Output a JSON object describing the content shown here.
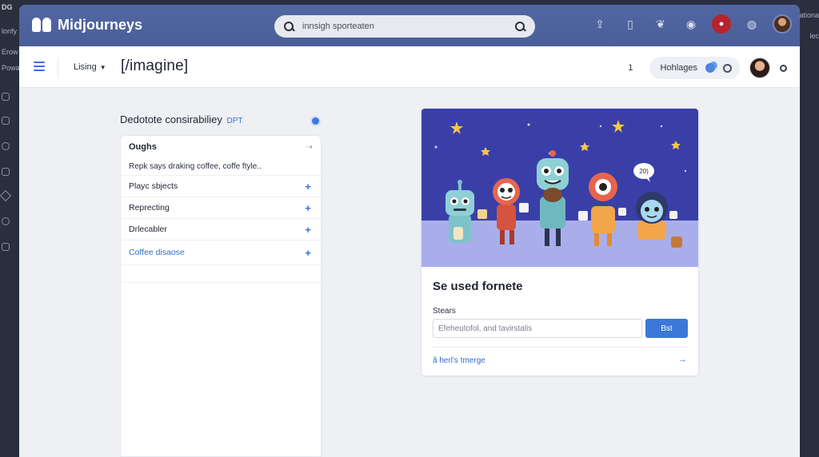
{
  "background": {
    "left_texts": [
      "DG",
      "lonfy",
      "Erow",
      "Powa"
    ],
    "right_texts": [
      "ationa",
      "lec"
    ]
  },
  "topbar": {
    "brand": "Midjourneys",
    "search_placeholder": "innsigh sporteaten",
    "icons": [
      "upload-icon",
      "bookmark-icon",
      "settings-swirl-icon",
      "location-icon",
      "record-icon",
      "globe-icon",
      "avatar"
    ]
  },
  "subbar": {
    "listing_label": "Lising",
    "command": "[/imagine]",
    "count": "1",
    "pill_label": "Hohlages"
  },
  "left_panel": {
    "title": "Dedotote consirabiliey",
    "title_tag": "DPT",
    "head": "Oughs",
    "description": "Repk says draking coffee, coffe ftyle..",
    "items": [
      {
        "label": "Playc sbjects"
      },
      {
        "label": "Reprecting"
      },
      {
        "label": "Drlecabler"
      },
      {
        "label": "Coffee disaose"
      }
    ]
  },
  "card": {
    "speech_text": "20)",
    "title": "Se used fornete",
    "field_label": "Stears",
    "input_value": "Efeheutofol, and tavirstalis",
    "button_label": "Bst",
    "link_text": "ã herl's tmerge",
    "accent_color": "#3b78d8",
    "art_bg_color": "#3a3fa8"
  }
}
